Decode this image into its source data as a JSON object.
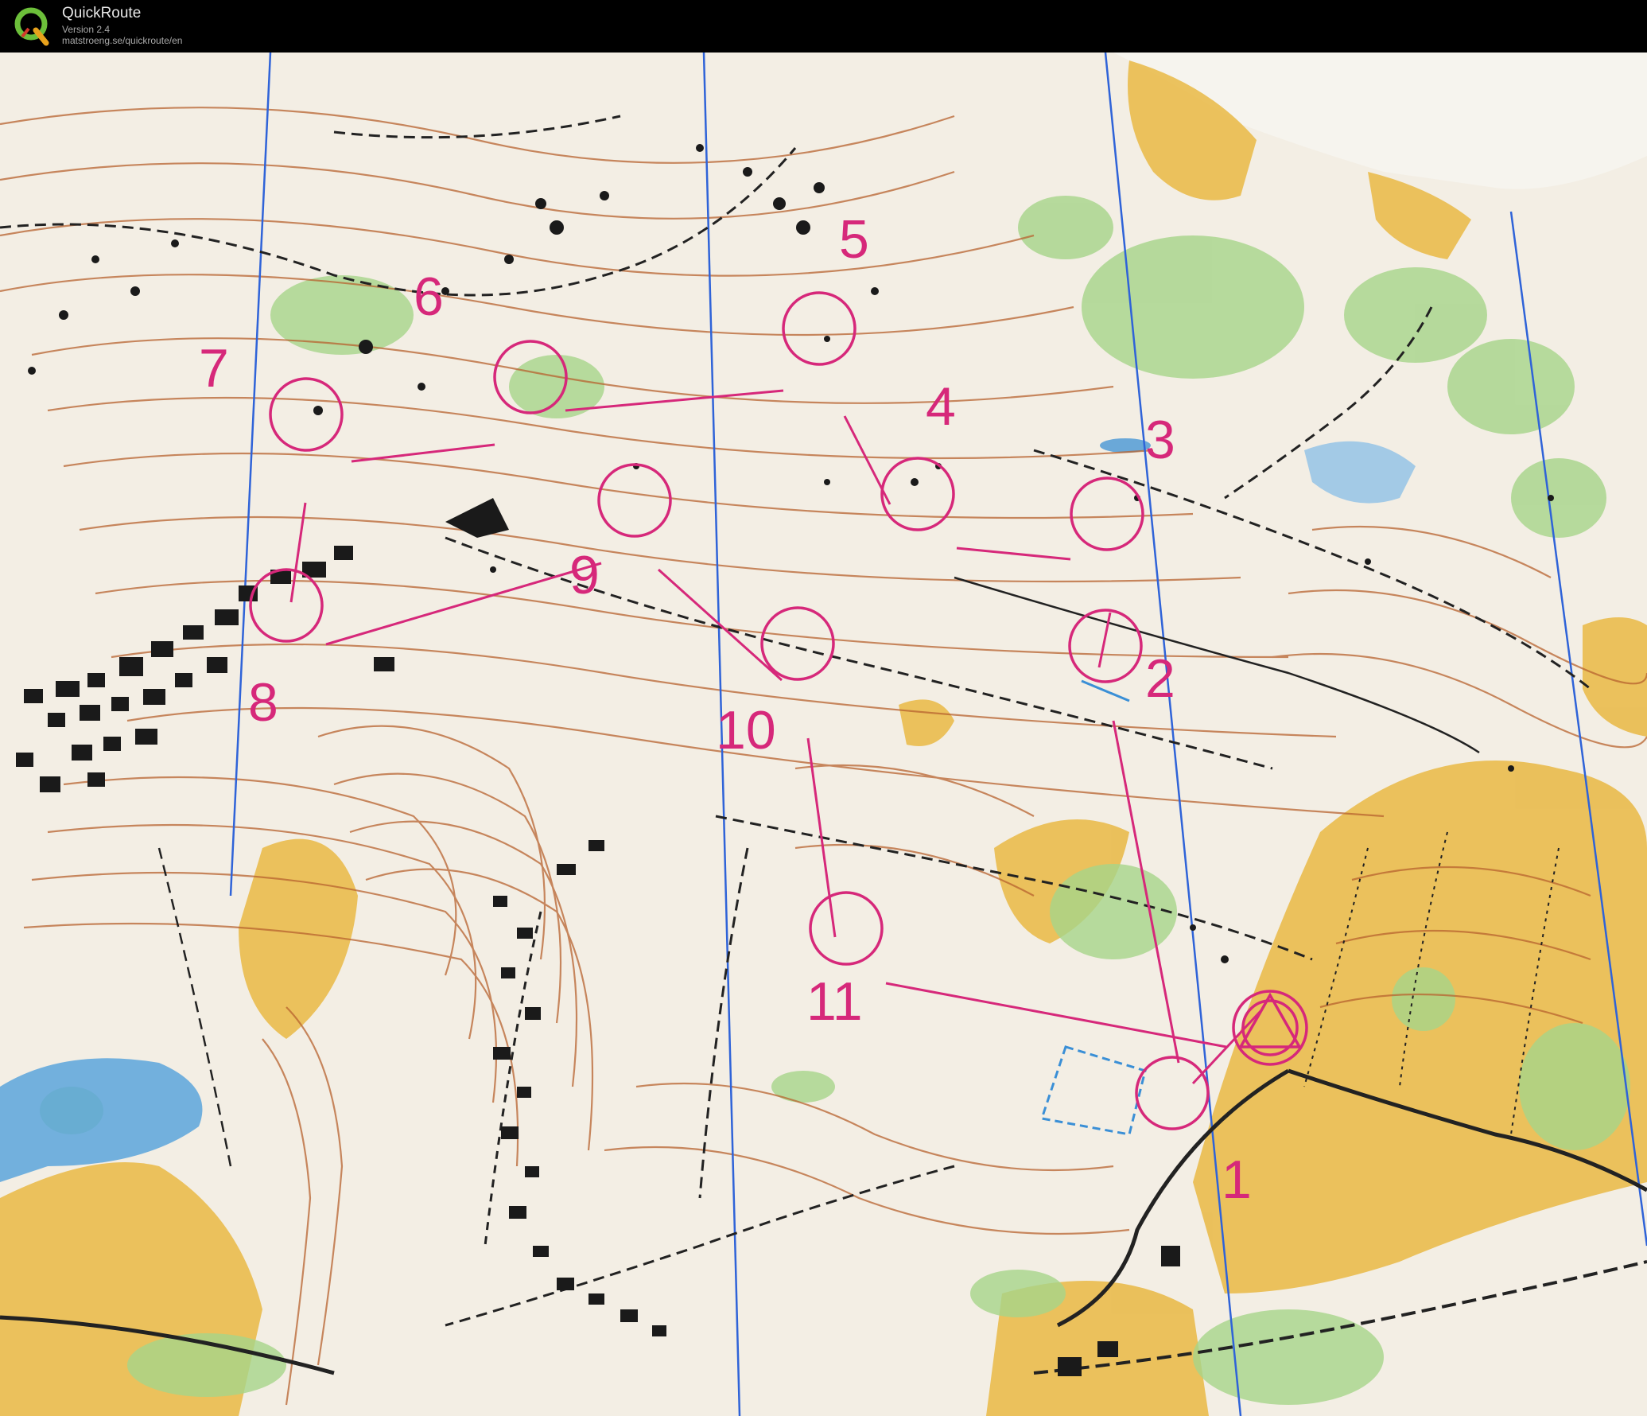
{
  "app": {
    "name": "QuickRoute",
    "version": "Version 2.4",
    "url": "matstroeng.se/quickroute/en",
    "logo_letter": "Q"
  },
  "colors": {
    "course": "#d6287a",
    "contour": "#b8632f",
    "open_land": "#e9b844",
    "vegetation": "#a6d58a",
    "water": "#3a8fd6",
    "magnetic_north": "#2f63d8",
    "paper": "#f3eee4"
  },
  "course": {
    "start": {
      "label": "start-triangle"
    },
    "finish": {
      "label": "finish-circle"
    },
    "controls": [
      {
        "label": "1"
      },
      {
        "label": "2"
      },
      {
        "label": "3"
      },
      {
        "label": "4"
      },
      {
        "label": "5"
      },
      {
        "label": "6"
      },
      {
        "label": "7"
      },
      {
        "label": "8"
      },
      {
        "label": "9"
      },
      {
        "label": "10"
      },
      {
        "label": "11"
      }
    ]
  }
}
